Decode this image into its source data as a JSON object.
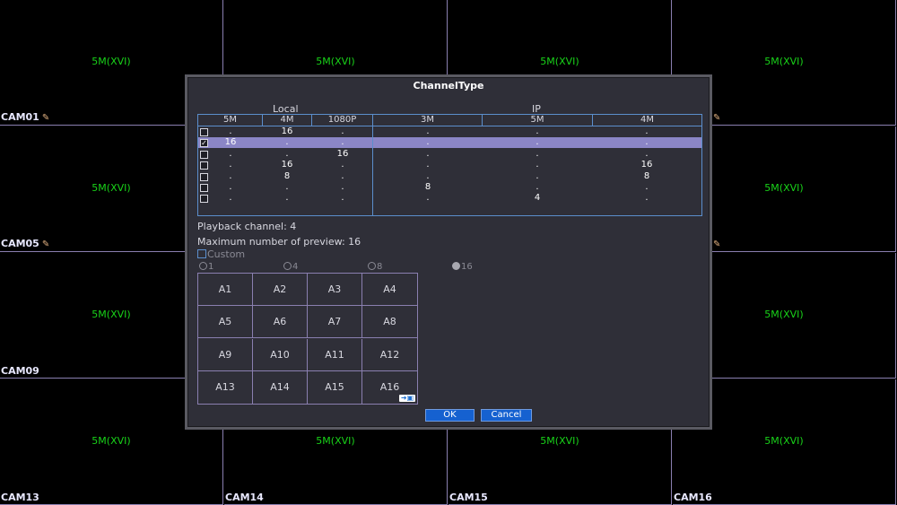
{
  "cameras": [
    {
      "resolution": "5M(XVI)",
      "name": "CAM01",
      "flag": true
    },
    {
      "resolution": "5M(XVI)",
      "name": ""
    },
    {
      "resolution": "5M(XVI)",
      "name": ""
    },
    {
      "resolution": "5M(XVI)",
      "name": "",
      "flag": true
    },
    {
      "resolution": "5M(XVI)",
      "name": "CAM05",
      "flag": true
    },
    {
      "resolution": "",
      "name": ""
    },
    {
      "resolution": "",
      "name": ""
    },
    {
      "resolution": "5M(XVI)",
      "name": "",
      "flag": true
    },
    {
      "resolution": "5M(XVI)",
      "name": "CAM09"
    },
    {
      "resolution": "",
      "name": ""
    },
    {
      "resolution": "",
      "name": ""
    },
    {
      "resolution": "5M(XVI)",
      "name": ""
    },
    {
      "resolution": "5M(XVI)",
      "name": "CAM13"
    },
    {
      "resolution": "5M(XVI)",
      "name": "CAM14"
    },
    {
      "resolution": "5M(XVI)",
      "name": "CAM15"
    },
    {
      "resolution": "5M(XVI)",
      "name": "CAM16"
    }
  ],
  "dialog": {
    "title": "ChannelType",
    "group_local": "Local",
    "group_ip": "IP",
    "columns": [
      "5M",
      "4M",
      "1080P",
      "3M",
      "5M",
      "4M"
    ],
    "rows": [
      {
        "checked": false,
        "selected": false,
        "cells": [
          ".",
          "16",
          ".",
          ".",
          ".",
          "."
        ]
      },
      {
        "checked": true,
        "selected": true,
        "cells": [
          "16",
          ".",
          ".",
          ".",
          ".",
          "."
        ]
      },
      {
        "checked": false,
        "selected": false,
        "cells": [
          ".",
          ".",
          "16",
          ".",
          ".",
          "."
        ]
      },
      {
        "checked": false,
        "selected": false,
        "cells": [
          ".",
          "16",
          ".",
          ".",
          ".",
          "16"
        ]
      },
      {
        "checked": false,
        "selected": false,
        "cells": [
          ".",
          "8",
          ".",
          ".",
          ".",
          "8"
        ]
      },
      {
        "checked": false,
        "selected": false,
        "cells": [
          ".",
          ".",
          ".",
          "8",
          ".",
          "."
        ]
      },
      {
        "checked": false,
        "selected": false,
        "cells": [
          ".",
          ".",
          ".",
          ".",
          "4",
          "."
        ]
      }
    ],
    "playback_channel": "Playback channel: 4",
    "max_preview": "Maximum number of preview: 16",
    "custom_label": "Custom",
    "radios": [
      {
        "label": "1",
        "selected": false
      },
      {
        "label": "4",
        "selected": false
      },
      {
        "label": "8",
        "selected": false
      },
      {
        "label": "16",
        "selected": true
      }
    ],
    "preview_cells": [
      "A1",
      "A2",
      "A3",
      "A4",
      "A5",
      "A6",
      "A7",
      "A8",
      "A9",
      "A10",
      "A11",
      "A12",
      "A13",
      "A14",
      "A15",
      "A16"
    ],
    "swap_icon": "arrow-swap-icon",
    "ok_label": "OK",
    "cancel_label": "Cancel"
  },
  "colors": {
    "resolution_text": "#19d319",
    "selected_row": "#8b86c6",
    "button": "#1561d0",
    "table_border": "#5b8ecc"
  }
}
